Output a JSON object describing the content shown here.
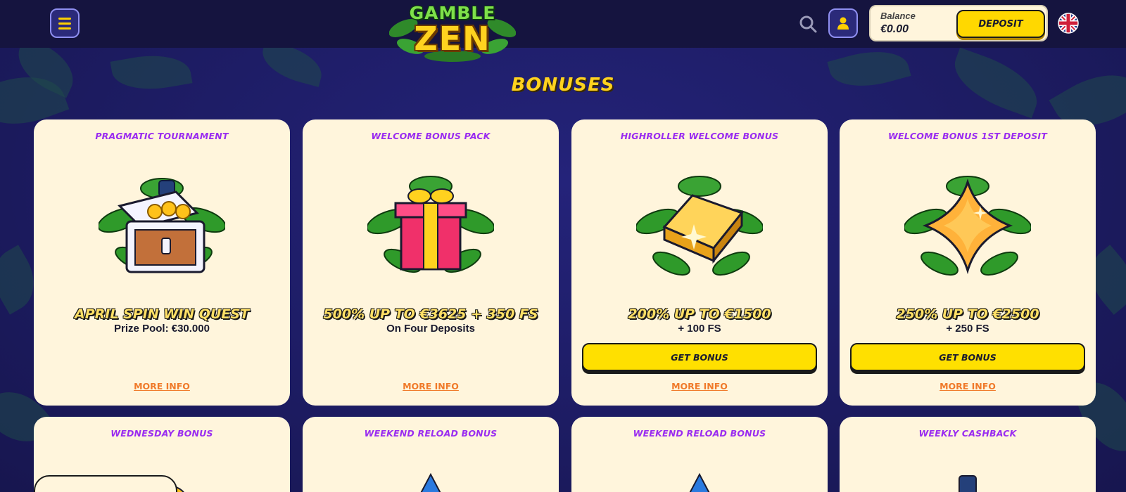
{
  "header": {
    "logo_top": "GAMBLE",
    "logo_bottom": "ZEN",
    "balance_label": "Balance",
    "balance_value": "€0.00",
    "deposit_label": "DEPOSIT",
    "icons": [
      "menu-icon",
      "search-icon",
      "user-icon",
      "uk-flag-icon"
    ]
  },
  "page": {
    "title": "BONUSES"
  },
  "cards_row1": [
    {
      "title": "PRAGMATIC TOURNAMENT",
      "headline": "APRIL SPIN WIN QUEST",
      "sub": "Prize Pool: €30.000",
      "more_info": "MORE INFO",
      "art": "treasure-chest-icon"
    },
    {
      "title": "WELCOME BONUS PACK",
      "headline": "500% UP TO €3625 + 350 FS",
      "sub": "On Four Deposits",
      "more_info": "MORE INFO",
      "art": "gift-box-icon"
    },
    {
      "title": "HIGHROLLER WELCOME BONUS",
      "headline": "200% UP TO €1500",
      "sub": "+ 100 FS",
      "button": "GET BONUS",
      "more_info": "MORE INFO",
      "art": "gold-bar-icon"
    },
    {
      "title": "WELCOME BONUS 1ST DEPOSIT",
      "headline": "250% UP TO €2500",
      "sub": "+ 250 FS",
      "button": "GET BONUS",
      "more_info": "MORE INFO",
      "art": "gold-star-gem-icon"
    }
  ],
  "cards_row2": [
    {
      "title": "WEDNESDAY BONUS"
    },
    {
      "title": "WEEKEND RELOAD BONUS"
    },
    {
      "title": "WEEKEND RELOAD BONUS"
    },
    {
      "title": "WEEKLY CASHBACK"
    }
  ],
  "colors": {
    "background": "#1c1b5e",
    "card": "#fff5dc",
    "accent_yellow": "#ffd800",
    "title_purple": "#9a2cf0",
    "link_orange": "#f07a2a"
  }
}
